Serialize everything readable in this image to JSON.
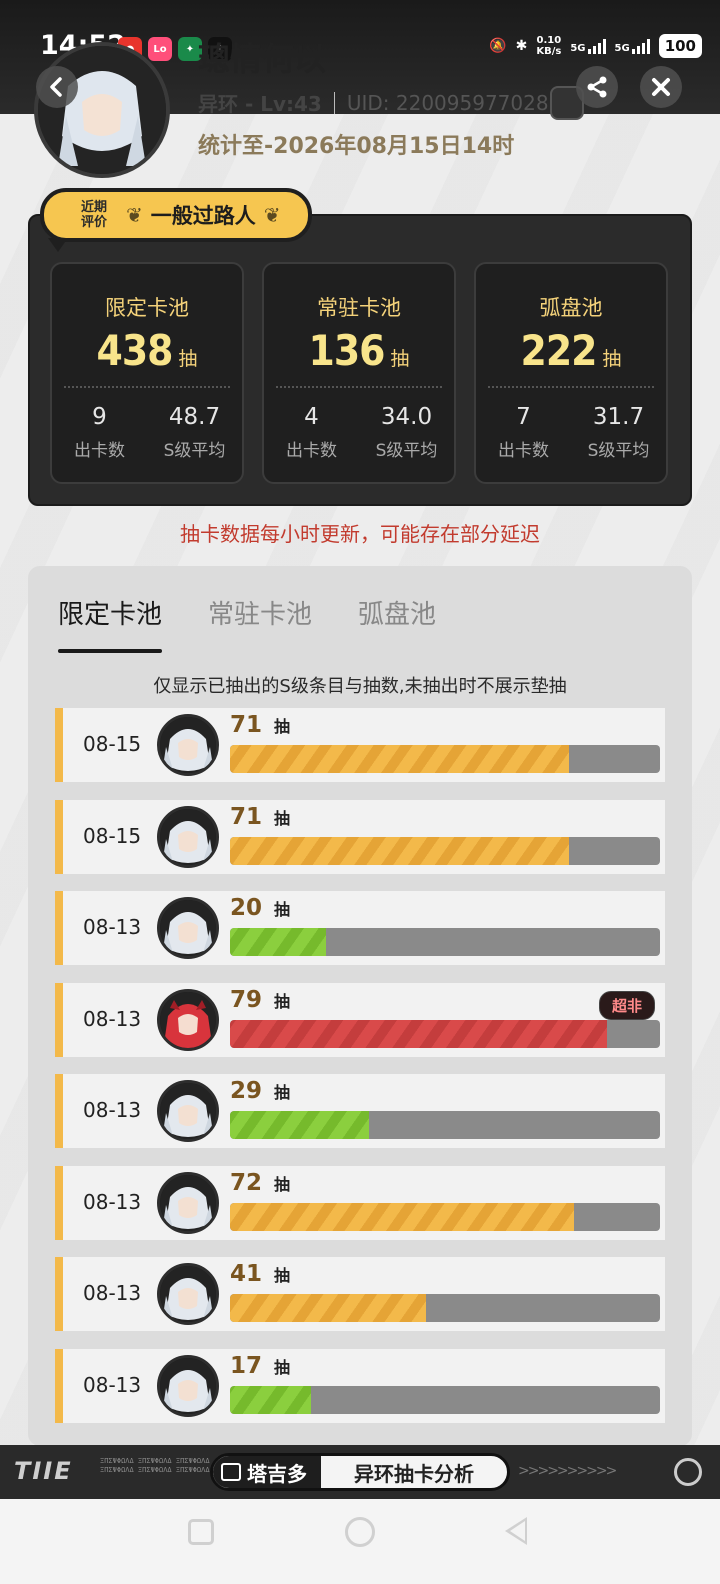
{
  "status_bar": {
    "time": "14:52",
    "speed_value": "0.10",
    "speed_unit": "KB/s",
    "net1": "5G",
    "net2": "5G",
    "battery": "100"
  },
  "profile": {
    "name": "璁情何以",
    "game": "异环 - Lv:43",
    "uid": "UID: 220095977028",
    "stat_time": "统计至-2026年08月15日14时"
  },
  "rating": {
    "label_line1": "近期",
    "label_line2": "评价",
    "value": "一般过路人"
  },
  "pools": [
    {
      "title": "限定卡池",
      "count": "438",
      "unit": "抽",
      "cards": "9",
      "cards_label": "出卡数",
      "avg": "48.7",
      "avg_label": "S级平均"
    },
    {
      "title": "常驻卡池",
      "count": "136",
      "unit": "抽",
      "cards": "4",
      "cards_label": "出卡数",
      "avg": "34.0",
      "avg_label": "S级平均"
    },
    {
      "title": "弧盘池",
      "count": "222",
      "unit": "抽",
      "cards": "7",
      "cards_label": "出卡数",
      "avg": "31.7",
      "avg_label": "S级平均"
    }
  ],
  "notice": "抽卡数据每小时更新，可能存在部分延迟",
  "tabs": [
    {
      "label": "限定卡池",
      "active": true
    },
    {
      "label": "常驻卡池",
      "active": false
    },
    {
      "label": "弧盘池",
      "active": false
    }
  ],
  "hint": "仅显示已抽出的S级条目与抽数,未抽出时不展示垫抽",
  "pull_unit": "抽",
  "max_pulls": 90,
  "records": [
    {
      "date": "08-15",
      "pulls": "71",
      "pulls_value": 71,
      "color": "gold",
      "character": "silver-hair",
      "tag": ""
    },
    {
      "date": "08-15",
      "pulls": "71",
      "pulls_value": 71,
      "color": "gold",
      "character": "silver-hair",
      "tag": ""
    },
    {
      "date": "08-13",
      "pulls": "20",
      "pulls_value": 20,
      "color": "green",
      "character": "silver-hair",
      "tag": ""
    },
    {
      "date": "08-13",
      "pulls": "79",
      "pulls_value": 79,
      "color": "red",
      "character": "red-hair",
      "tag": "超非"
    },
    {
      "date": "08-13",
      "pulls": "29",
      "pulls_value": 29,
      "color": "green",
      "character": "silver-hair",
      "tag": ""
    },
    {
      "date": "08-13",
      "pulls": "72",
      "pulls_value": 72,
      "color": "gold",
      "character": "silver-hair",
      "tag": ""
    },
    {
      "date": "08-13",
      "pulls": "41",
      "pulls_value": 41,
      "color": "gold",
      "character": "silver-hair",
      "tag": ""
    },
    {
      "date": "08-13",
      "pulls": "17",
      "pulls_value": 17,
      "color": "green",
      "character": "silver-hair",
      "tag": ""
    }
  ],
  "footer": {
    "brand": "TIIE",
    "logo": "塔吉多",
    "title": "异环抽卡分析"
  },
  "colors": {
    "accent_gold": "#f3b94a",
    "green": "#8bcf3e",
    "red": "#d94a4a",
    "notice_red": "#c23b2e"
  }
}
